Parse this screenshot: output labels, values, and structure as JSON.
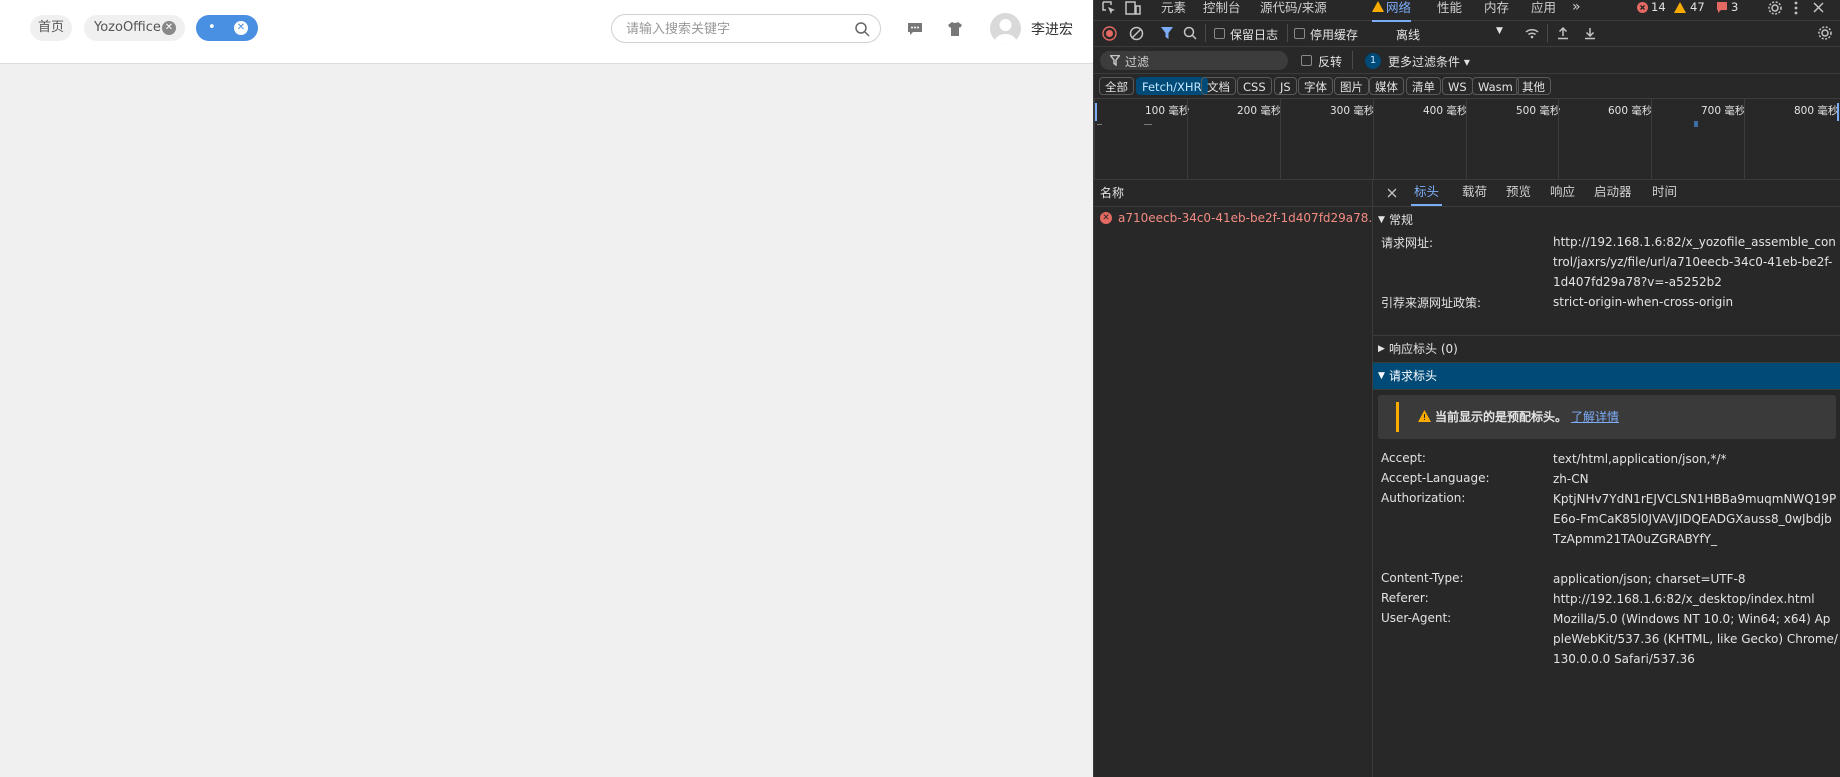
{
  "app": {
    "tabs": [
      {
        "label": "首页"
      },
      {
        "label": "YozoOffice"
      },
      {
        "label": "•"
      }
    ],
    "search": {
      "placeholder": "请输入搜索关键字"
    },
    "user": {
      "name": "李进宏"
    }
  },
  "devtools": {
    "main_tabs": [
      "元素",
      "控制台",
      "源代码/来源",
      "网络",
      "性能",
      "内存",
      "应用"
    ],
    "more_tabs": "»",
    "counters": {
      "errors": "14",
      "warnings": "47",
      "issues": "3"
    },
    "toolbar": {
      "preserve_log": "保留日志",
      "disable_cache": "停用缓存",
      "throttle": "离线"
    },
    "filter": {
      "placeholder": "过滤",
      "invert": "反转",
      "more_count": "1",
      "more_filters": "更多过滤条件 ▾"
    },
    "type_filters": [
      "全部",
      "Fetch/XHR",
      "文档",
      "CSS",
      "JS",
      "字体",
      "图片",
      "媒体",
      "清单",
      "WS",
      "Wasm",
      "其他"
    ],
    "timeline_labels": [
      "100 毫秒",
      "200 毫秒",
      "300 毫秒",
      "400 毫秒",
      "500 毫秒",
      "600 毫秒",
      "700 毫秒",
      "800 毫秒"
    ],
    "list": {
      "header": "名称",
      "rows": [
        {
          "name": "a710eecb-34c0-41eb-be2f-1d407fd29a78..."
        }
      ]
    },
    "detail_tabs": [
      "标头",
      "载荷",
      "预览",
      "响应",
      "启动器",
      "时间"
    ],
    "general": {
      "title": "常规",
      "request_url_label": "请求网址:",
      "request_url": "http://192.168.1.6:82/x_yozofile_assemble_control/jaxrs/yz/file/url/a710eecb-34c0-41eb-be2f-1d407fd29a78?v=-a5252b2",
      "referrer_policy_label": "引荐来源网址政策:",
      "referrer_policy": "strict-origin-when-cross-origin"
    },
    "response_headers": {
      "title": "响应标头 (0)"
    },
    "request_headers": {
      "title": "请求标头",
      "warning": "当前显示的是预配标头。",
      "learn_more": "了解详情",
      "items": [
        {
          "k": "Accept:",
          "v": "text/html,application/json,*/*"
        },
        {
          "k": "Accept-Language:",
          "v": "zh-CN"
        },
        {
          "k": "Authorization:",
          "v": "KptjNHv7YdN1rEJVCLSN1HBBa9muqmNWQ19PE6o-FmCaK85l0JVAVJIDQEADGXauss8_0wJbdjbTzApmm21TA0uZGRABYfY_"
        },
        {
          "k": "Content-Type:",
          "v": "application/json; charset=UTF-8"
        },
        {
          "k": "Referer:",
          "v": "http://192.168.1.6:82/x_desktop/index.html"
        },
        {
          "k": "User-Agent:",
          "v": "Mozilla/5.0 (Windows NT 10.0; Win64; x64) AppleWebKit/537.36 (KHTML, like Gecko) Chrome/130.0.0.0 Safari/537.36"
        }
      ]
    }
  }
}
